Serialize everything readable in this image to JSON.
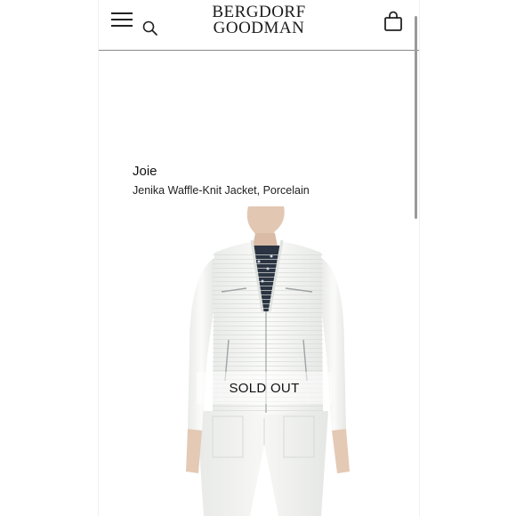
{
  "header": {
    "logo_line1": "BERGDORF",
    "logo_line2": "GOODMAN"
  },
  "product": {
    "brand": "Joie",
    "name": "Jenika Waffle-Knit Jacket, Porcelain",
    "status": "SOLD OUT"
  },
  "icons": [
    "menu-icon",
    "search-icon",
    "shopping-bag-icon"
  ],
  "colors": {
    "text": "#111111",
    "divider": "#8a8a8a",
    "jacket": "#f4f5f3",
    "background": "#ffffff"
  }
}
